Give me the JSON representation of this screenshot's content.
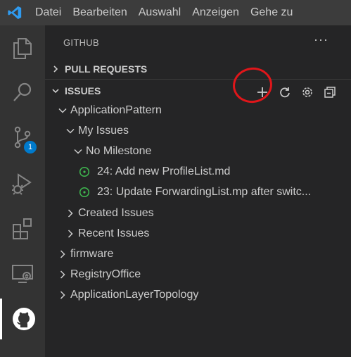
{
  "menubar": {
    "items": [
      "Datei",
      "Bearbeiten",
      "Auswahl",
      "Anzeigen",
      "Gehe zu"
    ]
  },
  "activity_bar": {
    "items": [
      {
        "name": "explorer-icon"
      },
      {
        "name": "search-icon"
      },
      {
        "name": "source-control-icon",
        "badge": "1"
      },
      {
        "name": "run-debug-icon"
      },
      {
        "name": "extensions-icon"
      },
      {
        "name": "remote-explorer-icon"
      },
      {
        "name": "github-icon",
        "active": true
      }
    ]
  },
  "sidebar": {
    "title": "GITHUB",
    "more": "···",
    "sections": {
      "pull_requests": "PULL REQUESTS",
      "issues": "ISSUES"
    },
    "tree": {
      "application_pattern": "ApplicationPattern",
      "my_issues": "My Issues",
      "no_milestone": "No Milestone",
      "issue_1": "24: Add new ProfileList.md",
      "issue_2": "23: Update ForwardingList.mp after switc...",
      "created_issues": "Created Issues",
      "recent_issues": "Recent Issues",
      "firmware": "firmware",
      "registry_office": "RegistryOffice",
      "application_layer_topology": "ApplicationLayerTopology"
    }
  },
  "colors": {
    "accent": "#007acc",
    "issue_open": "#3fb950",
    "annotation": "#e0161a"
  }
}
